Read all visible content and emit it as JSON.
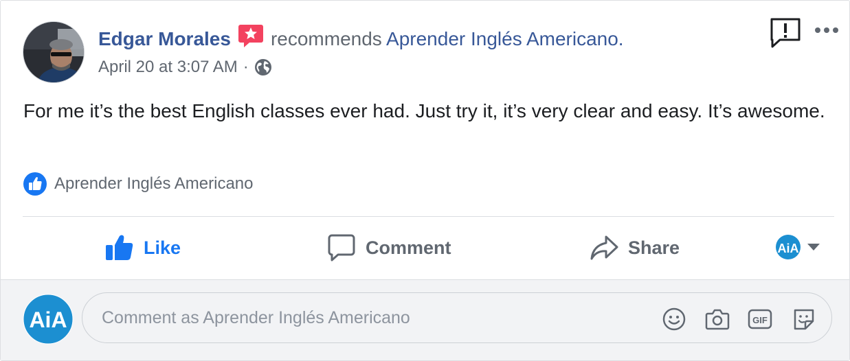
{
  "post": {
    "author": "Edgar Morales",
    "action_text": "recommends",
    "page_name": "Aprender Inglés Americano.",
    "timestamp": "April 20 at 3:07 AM",
    "separator": "·",
    "privacy_icon": "globe-icon",
    "body": "For me it’s the best English classes ever had. Just try it, it’s very clear and easy. It’s awesome.",
    "recommended_page": "Aprender Inglés Americano"
  },
  "actions": {
    "like_label": "Like",
    "comment_label": "Comment",
    "share_label": "Share"
  },
  "comment_box": {
    "placeholder": "Comment as Aprender Inglés Americano"
  },
  "colors": {
    "link_blue": "#385898",
    "like_blue": "#1877f2",
    "recommend_badge": "#f3425f",
    "aia_blue": "#1c8fd1"
  }
}
